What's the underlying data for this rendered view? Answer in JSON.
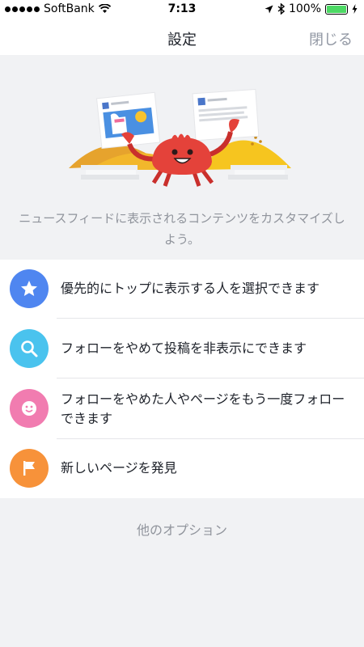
{
  "status_bar": {
    "carrier": "SoftBank",
    "time": "7:13",
    "battery": "100%",
    "battery_level": 1.0,
    "icons": [
      "signal-dots-icon",
      "wifi-icon",
      "location-icon",
      "bluetooth-icon",
      "battery-icon",
      "charging-icon"
    ]
  },
  "header": {
    "title": "設定",
    "close_label": "閉じる"
  },
  "hero": {
    "description": "ニュースフィードに表示されるコンテンツをカスタマイズしよう。"
  },
  "options": [
    {
      "label": "優先的にトップに表示する人を選択できます",
      "icon": "star-icon",
      "color": "#4f86f0"
    },
    {
      "label": "フォローをやめて投稿を非表示にできます",
      "icon": "search-icon",
      "color": "#4ac3ee"
    },
    {
      "label": "フォローをやめた人やページをもう一度フォローできます",
      "icon": "smile-icon",
      "color": "#f17cb0"
    },
    {
      "label": "新しいページを発見",
      "icon": "flag-icon",
      "color": "#f7923a"
    }
  ],
  "footer": {
    "more_options": "他のオプション"
  },
  "colors": {
    "background": "#f1f2f4",
    "secondary_text": "#90949c",
    "battery_green": "#4cd964"
  }
}
